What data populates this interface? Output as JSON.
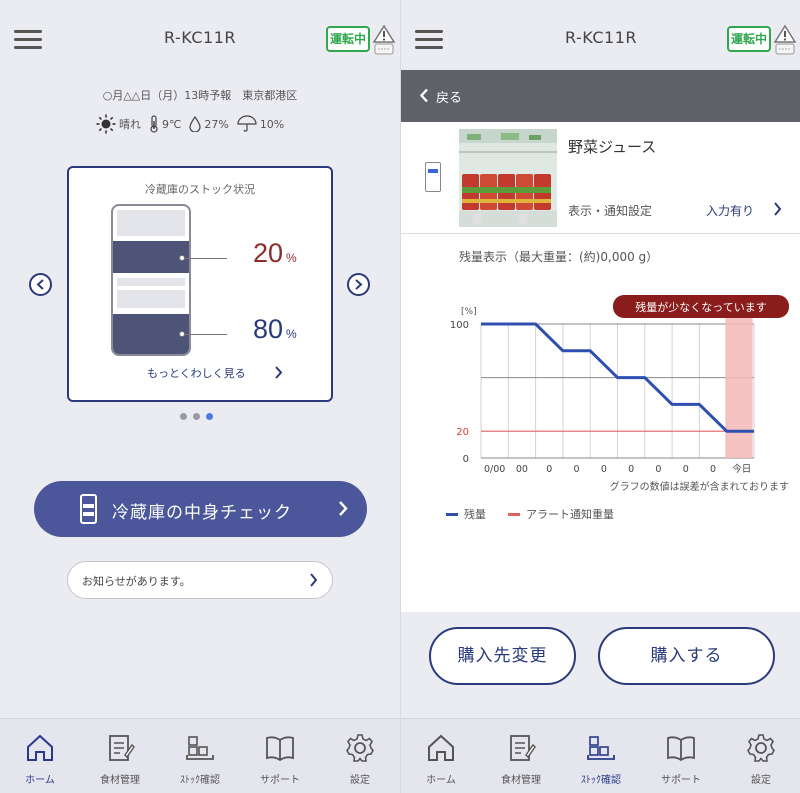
{
  "left": {
    "header": {
      "title": "R-KC11R",
      "status": "運転中"
    },
    "weather": {
      "forecast": "○月△△日（月）13時予報　東京都港区",
      "condition": "晴れ",
      "temperature": "9℃",
      "humidity": "27%",
      "rain": "10%"
    },
    "stock": {
      "title": "冷蔵庫のストック状況",
      "upper_percent": "20",
      "lower_percent": "80",
      "unit": "%",
      "more_link": "もっとくわしく見る"
    },
    "carousel": {
      "pages": 3,
      "active": 3
    },
    "check_button": "冷蔵庫の中身チェック",
    "notice": "お知らせがあります。",
    "tabs": [
      {
        "label": "ホーム",
        "icon": "home-icon"
      },
      {
        "label": "食材管理",
        "icon": "food-management-icon"
      },
      {
        "label": "ｽﾄｯｸ確認",
        "icon": "stock-icon"
      },
      {
        "label": "サポート",
        "icon": "book-icon"
      },
      {
        "label": "設定",
        "icon": "gear-icon"
      }
    ],
    "active_tab": "ホーム"
  },
  "right": {
    "header": {
      "title": "R-KC11R",
      "status": "運転中"
    },
    "back_label": "戻る",
    "product": {
      "name": "野菜ジュース",
      "setting_label": "表示・通知設定",
      "setting_value": "入力有り"
    },
    "remain_caption": "残量表示（最大重量：(約)0,000 g）",
    "chart_note": "グラフの数値は誤差が含まれております",
    "chart_alert": "残量が少なくなっています",
    "buttons": {
      "change_vendor": "購入先変更",
      "purchase": "購入する"
    },
    "tabs": [
      {
        "label": "ホーム",
        "icon": "home-icon"
      },
      {
        "label": "食材管理",
        "icon": "food-management-icon"
      },
      {
        "label": "ｽﾄｯｸ確認",
        "icon": "stock-icon"
      },
      {
        "label": "サポート",
        "icon": "book-icon"
      },
      {
        "label": "設定",
        "icon": "gear-icon"
      }
    ],
    "active_tab": "ｽﾄｯｸ確認"
  },
  "colors": {
    "accent": "#2a3a7a",
    "button_fill": "#4b569b",
    "status_green": "#2fa84f",
    "alert_red": "#e06060",
    "alert_banner": "#8b1c1c",
    "remain_line": "#2e4fb0"
  },
  "chart_data": {
    "type": "line",
    "ylabel": "[%]",
    "ylim": [
      0,
      100
    ],
    "yticks": [
      0,
      20,
      100
    ],
    "categories": [
      "0/00",
      "00",
      "0",
      "0",
      "0",
      "0",
      "0",
      "0",
      "0",
      "今日"
    ],
    "series": [
      {
        "name": "残量",
        "values": [
          100,
          100,
          100,
          80,
          80,
          60,
          60,
          40,
          40,
          20,
          20
        ]
      },
      {
        "name": "アラート通知重量",
        "values": [
          20,
          20
        ]
      }
    ],
    "alert_threshold": 20,
    "alert_text": "残量が少なくなっています",
    "highlight": "今日",
    "legend_position": "bottom-left"
  }
}
